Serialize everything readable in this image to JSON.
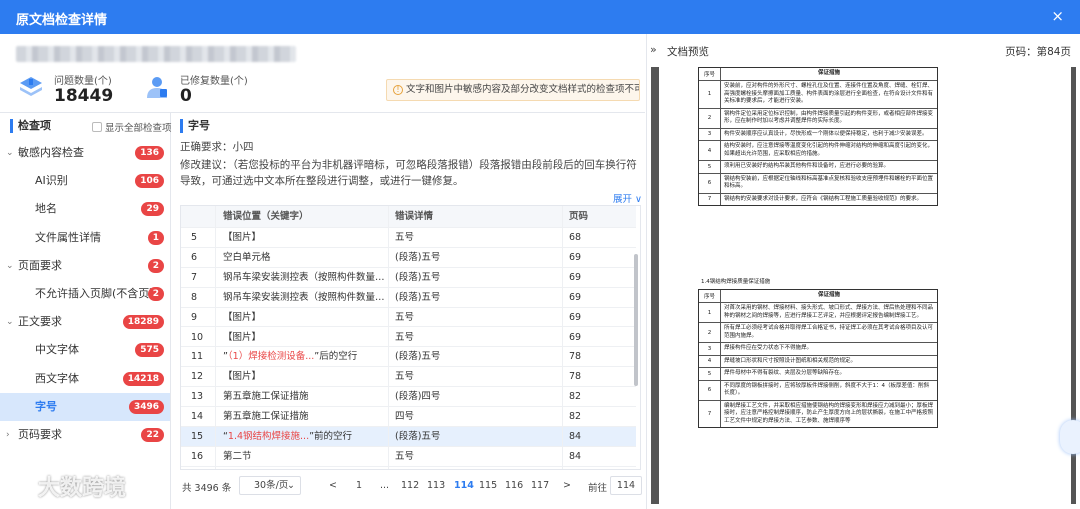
{
  "window": {
    "title": "原文档检查详情",
    "close": "×"
  },
  "stats": [
    {
      "label": "问题数量(个)",
      "value": "18449"
    },
    {
      "label": "已修复数量(个)",
      "value": "0"
    }
  ],
  "warning": "文字和图片中敏感内容及部分改变文档样式的检查项不可修复",
  "nav": {
    "title": "检查项",
    "show_all": "显示全部检查项",
    "items": [
      {
        "label": "敏感内容检查",
        "count": "136",
        "level": 0,
        "expanded": true
      },
      {
        "label": "AI识别",
        "count": "106",
        "level": 1
      },
      {
        "label": "地名",
        "count": "29",
        "level": 1
      },
      {
        "label": "文件属性详情",
        "count": "1",
        "level": 1
      },
      {
        "label": "页面要求",
        "count": "2",
        "level": 0,
        "expanded": true
      },
      {
        "label": "不允许插入页脚(不含页码)",
        "count": "2",
        "level": 1
      },
      {
        "label": "正文要求",
        "count": "18289",
        "level": 0,
        "expanded": true
      },
      {
        "label": "中文字体",
        "count": "575",
        "level": 1
      },
      {
        "label": "西文字体",
        "count": "14218",
        "level": 1
      },
      {
        "label": "字号",
        "count": "3496",
        "level": 1,
        "active": true
      },
      {
        "label": "页码要求",
        "count": "22",
        "level": 0,
        "expanded": false
      }
    ]
  },
  "detail": {
    "title": "字号",
    "requirement": "正确要求：小四",
    "suggestion": "修改建议：（若您投标的平台为非机器评暗标，可忽略段落报错）段落报错由段前段后的回车换行符导致，可通过选中文本所在整段进行调整，或进行一键修复。",
    "expand": "展开 ∨"
  },
  "table": {
    "columns": [
      "",
      "错误位置（关键字）",
      "错误详情",
      "页码"
    ],
    "rows": [
      {
        "no": "5",
        "pos": "【图片】",
        "detail": "五号",
        "page": "68"
      },
      {
        "no": "6",
        "pos": "空白单元格",
        "detail": "(段落)五号",
        "page": "69"
      },
      {
        "no": "7",
        "pos": "钢吊车梁安装测控表（按照构件数量抽查...",
        "detail": "(段落)五号",
        "page": "69"
      },
      {
        "no": "8",
        "pos": "钢吊车梁安装测控表（按照构件数量抽查...",
        "detail": "(段落)五号",
        "page": "69"
      },
      {
        "no": "9",
        "pos": "【图片】",
        "detail": "五号",
        "page": "69"
      },
      {
        "no": "10",
        "pos": "【图片】",
        "detail": "五号",
        "page": "69"
      },
      {
        "no": "11",
        "pos_pre": "”",
        "pos_red": "（1）焊接检测设备...",
        "pos_post": "”后的空行",
        "detail": "(段落)五号",
        "page": "78"
      },
      {
        "no": "12",
        "pos": "【图片】",
        "detail": "五号",
        "page": "78"
      },
      {
        "no": "13",
        "pos": "第五章施工保证措施",
        "detail": "(段落)四号",
        "page": "82"
      },
      {
        "no": "14",
        "pos": "第五章施工保证措施",
        "detail": "四号",
        "page": "82"
      },
      {
        "no": "15",
        "pos_pre": "“",
        "pos_red": "1.4钢结构焊接施...",
        "pos_post": "”前的空行",
        "detail": "(段落)五号",
        "page": "84",
        "selected": true
      },
      {
        "no": "16",
        "pos": "第二节",
        "detail": "五号",
        "page": "84"
      }
    ]
  },
  "pager": {
    "total": "共 3496 条",
    "size": "30条/页",
    "pages": [
      "<",
      "1",
      "...",
      "112",
      "113",
      "114",
      "115",
      "116",
      "117",
      ">"
    ],
    "current": "114",
    "goto_label": "前往",
    "goto_value": "114"
  },
  "preview": {
    "collapse": "»",
    "title": "文档预览",
    "page_label": "页码：第84页",
    "table1": {
      "head": [
        "序号",
        "保证措施"
      ],
      "rows": [
        [
          "1",
          "安装前，应对构件的外形尺寸、螺栓孔位及位置、连接件位置及角度、焊缝、栓钉焊、高强度螺栓接头摩擦面加工质量、构件表面的涂层进行全面检查，在符合设计文件和有关标准的要求后，才能进行安装。"
        ],
        [
          "2",
          "钢构件定位采用定位标识控制，由构件焊接质量引起的构件变形，或者相应部件焊接变形，应在制作时加以考虑并调整焊件的实际长度。"
        ],
        [
          "3",
          "构件安装顺序应认真设计，尽快形成一个刚体以便保持稳定，也利于减少安装误差。"
        ],
        [
          "4",
          "结构安装时，应注意焊接等温度变化引起的构件伸缩对结构的伸缩和高度引起的变化，如果超出允许范围，应采取相应的措施。"
        ],
        [
          "5",
          "须利用已安装好的结构吊装其他构件和设备时，应进行必要的验算。"
        ],
        [
          "6",
          "钢结构安装前，应根据定位轴线和标高基准点复核和验收支座预埋件和螺栓的平面位置和标高。"
        ],
        [
          "7",
          "钢结构的安装要求对设计要求，应符合《钢结构工程施工质量验收规范》的要求。"
        ]
      ]
    },
    "caption": "1.4钢结构焊接质量保证措施",
    "table2": {
      "head": [
        "序号",
        "保证措施"
      ],
      "rows": [
        [
          "1",
          "对首次采用的钢材、焊接材料、接头形式、坡口形式、焊接方法、焊后热处理和不同品种的钢材之间的焊接等，应进行焊接工艺评定，并应根据评定报告编制焊接工艺。"
        ],
        [
          "2",
          "所有焊工必须经考试合格并取得焊工合格证书，持证焊工必须在其考试合格项目及认可范围内施焊。"
        ],
        [
          "3",
          "焊接构件应在受力状态下不得施焊。"
        ],
        [
          "4",
          "焊缝坡口形状和尺寸按照设计图纸和相关规范的规定。"
        ],
        [
          "5",
          "焊件母材中不得有裂纹、夹层及分层等缺陷存在。"
        ],
        [
          "6",
          "不同厚度的钢板拼接时，应将较厚板件焊接侧削，斜度不大于1：4（板厚差值：削斜长度）。"
        ],
        [
          "7",
          "编制焊接工艺文件，并采取相应措施使钢结构的焊接变形和焊接应力减到最小；厚板焊接时，应注意严格控制焊接顺序，防止产生厚度方向上的层状撕裂，在施工中严格按照工艺文件中规定的焊接方法、工艺参数、施焊顺序等"
        ]
      ]
    },
    "page_number": "84"
  },
  "watermark": "大数跨境"
}
